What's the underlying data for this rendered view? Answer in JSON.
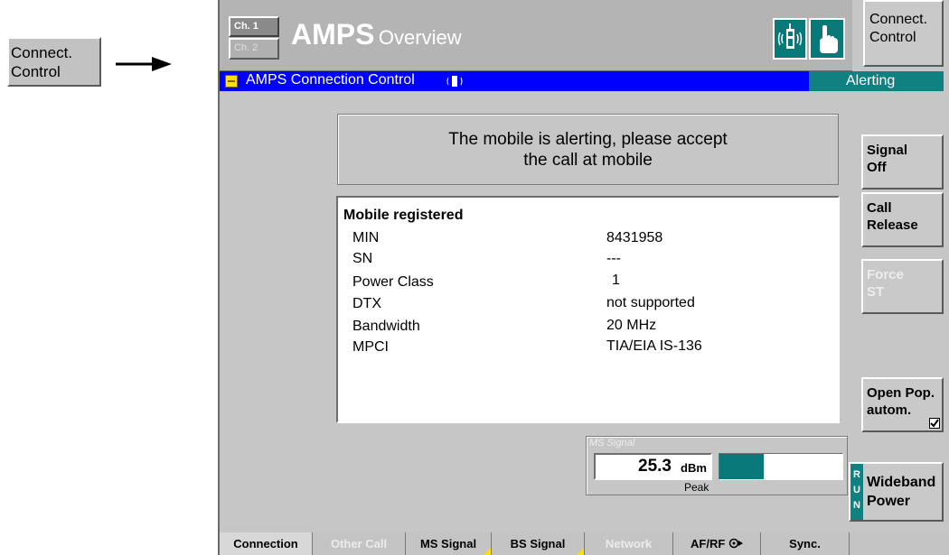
{
  "left_button": {
    "line1": "Connect.",
    "line2": "Control"
  },
  "header": {
    "ch1": "Ch. 1",
    "ch2": "Ch. 2",
    "title_big": "AMPS",
    "title_small": "Overview",
    "connect_btn": {
      "line1": "Connect.",
      "line2": "Control"
    }
  },
  "titlebar": {
    "label": "AMPS Connection Control",
    "status": "Alerting"
  },
  "message": {
    "line1": "The mobile is alerting, please accept",
    "line2": "the call at mobile"
  },
  "info": {
    "heading": "Mobile registered",
    "rows": [
      {
        "label": "MIN",
        "value": "8431958"
      },
      {
        "label": "SN",
        "value": "---"
      },
      {
        "label": "Power Class",
        "value": "1"
      },
      {
        "label": "DTX",
        "value": "not supported"
      },
      {
        "label": "Bandwidth",
        "value": "20 MHz"
      },
      {
        "label": "MPCI",
        "value": "TIA/EIA IS-136"
      }
    ]
  },
  "softkeys": [
    {
      "line1": "Signal",
      "line2": "Off",
      "enabled": true
    },
    {
      "line1": "Call",
      "line2": "Release",
      "enabled": true
    },
    {
      "line1": "Force",
      "line2": "ST",
      "enabled": false
    },
    {
      "line1": "Open Pop.",
      "line2": "autom.",
      "enabled": true,
      "checked": true
    }
  ],
  "meter": {
    "caption": "MS Signal",
    "value": "25.3",
    "unit": "dBm",
    "sub": "Peak",
    "bar_fraction": 0.36
  },
  "wideband": {
    "run": "RUN",
    "line1": "Wideband",
    "line2": "Power"
  },
  "tabs": [
    {
      "label": "Connection",
      "active": true,
      "enabled": true,
      "marker": false
    },
    {
      "label": "Other Call",
      "active": false,
      "enabled": false,
      "marker": false
    },
    {
      "label": "MS Signal",
      "active": false,
      "enabled": true,
      "marker": true
    },
    {
      "label": "BS Signal",
      "active": false,
      "enabled": true,
      "marker": true
    },
    {
      "label": "Network",
      "active": false,
      "enabled": false,
      "marker": false
    },
    {
      "label": "AF/RF",
      "active": false,
      "enabled": true,
      "marker": false
    },
    {
      "label": "Sync.",
      "active": false,
      "enabled": true,
      "marker": false
    }
  ],
  "colors": {
    "titlebar_bg": "#0000ff",
    "status_bg": "#108080",
    "meter_bar": "#087878",
    "panel_bg": "#c8c8c8",
    "tab_marker": "#ffe000"
  }
}
